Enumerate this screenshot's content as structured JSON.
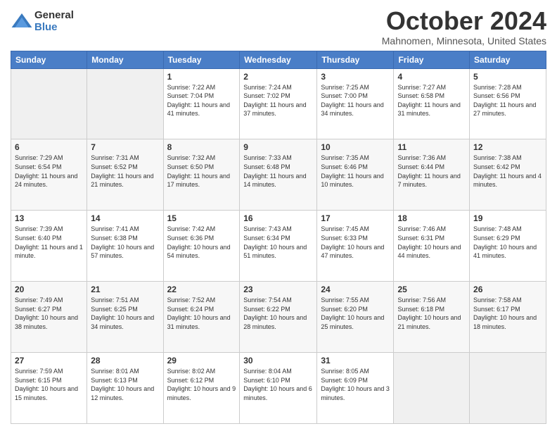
{
  "logo": {
    "general": "General",
    "blue": "Blue"
  },
  "title": "October 2024",
  "location": "Mahnomen, Minnesota, United States",
  "days_of_week": [
    "Sunday",
    "Monday",
    "Tuesday",
    "Wednesday",
    "Thursday",
    "Friday",
    "Saturday"
  ],
  "weeks": [
    [
      {
        "day": "",
        "info": ""
      },
      {
        "day": "",
        "info": ""
      },
      {
        "day": "1",
        "info": "Sunrise: 7:22 AM\nSunset: 7:04 PM\nDaylight: 11 hours and 41 minutes."
      },
      {
        "day": "2",
        "info": "Sunrise: 7:24 AM\nSunset: 7:02 PM\nDaylight: 11 hours and 37 minutes."
      },
      {
        "day": "3",
        "info": "Sunrise: 7:25 AM\nSunset: 7:00 PM\nDaylight: 11 hours and 34 minutes."
      },
      {
        "day": "4",
        "info": "Sunrise: 7:27 AM\nSunset: 6:58 PM\nDaylight: 11 hours and 31 minutes."
      },
      {
        "day": "5",
        "info": "Sunrise: 7:28 AM\nSunset: 6:56 PM\nDaylight: 11 hours and 27 minutes."
      }
    ],
    [
      {
        "day": "6",
        "info": "Sunrise: 7:29 AM\nSunset: 6:54 PM\nDaylight: 11 hours and 24 minutes."
      },
      {
        "day": "7",
        "info": "Sunrise: 7:31 AM\nSunset: 6:52 PM\nDaylight: 11 hours and 21 minutes."
      },
      {
        "day": "8",
        "info": "Sunrise: 7:32 AM\nSunset: 6:50 PM\nDaylight: 11 hours and 17 minutes."
      },
      {
        "day": "9",
        "info": "Sunrise: 7:33 AM\nSunset: 6:48 PM\nDaylight: 11 hours and 14 minutes."
      },
      {
        "day": "10",
        "info": "Sunrise: 7:35 AM\nSunset: 6:46 PM\nDaylight: 11 hours and 10 minutes."
      },
      {
        "day": "11",
        "info": "Sunrise: 7:36 AM\nSunset: 6:44 PM\nDaylight: 11 hours and 7 minutes."
      },
      {
        "day": "12",
        "info": "Sunrise: 7:38 AM\nSunset: 6:42 PM\nDaylight: 11 hours and 4 minutes."
      }
    ],
    [
      {
        "day": "13",
        "info": "Sunrise: 7:39 AM\nSunset: 6:40 PM\nDaylight: 11 hours and 1 minute."
      },
      {
        "day": "14",
        "info": "Sunrise: 7:41 AM\nSunset: 6:38 PM\nDaylight: 10 hours and 57 minutes."
      },
      {
        "day": "15",
        "info": "Sunrise: 7:42 AM\nSunset: 6:36 PM\nDaylight: 10 hours and 54 minutes."
      },
      {
        "day": "16",
        "info": "Sunrise: 7:43 AM\nSunset: 6:34 PM\nDaylight: 10 hours and 51 minutes."
      },
      {
        "day": "17",
        "info": "Sunrise: 7:45 AM\nSunset: 6:33 PM\nDaylight: 10 hours and 47 minutes."
      },
      {
        "day": "18",
        "info": "Sunrise: 7:46 AM\nSunset: 6:31 PM\nDaylight: 10 hours and 44 minutes."
      },
      {
        "day": "19",
        "info": "Sunrise: 7:48 AM\nSunset: 6:29 PM\nDaylight: 10 hours and 41 minutes."
      }
    ],
    [
      {
        "day": "20",
        "info": "Sunrise: 7:49 AM\nSunset: 6:27 PM\nDaylight: 10 hours and 38 minutes."
      },
      {
        "day": "21",
        "info": "Sunrise: 7:51 AM\nSunset: 6:25 PM\nDaylight: 10 hours and 34 minutes."
      },
      {
        "day": "22",
        "info": "Sunrise: 7:52 AM\nSunset: 6:24 PM\nDaylight: 10 hours and 31 minutes."
      },
      {
        "day": "23",
        "info": "Sunrise: 7:54 AM\nSunset: 6:22 PM\nDaylight: 10 hours and 28 minutes."
      },
      {
        "day": "24",
        "info": "Sunrise: 7:55 AM\nSunset: 6:20 PM\nDaylight: 10 hours and 25 minutes."
      },
      {
        "day": "25",
        "info": "Sunrise: 7:56 AM\nSunset: 6:18 PM\nDaylight: 10 hours and 21 minutes."
      },
      {
        "day": "26",
        "info": "Sunrise: 7:58 AM\nSunset: 6:17 PM\nDaylight: 10 hours and 18 minutes."
      }
    ],
    [
      {
        "day": "27",
        "info": "Sunrise: 7:59 AM\nSunset: 6:15 PM\nDaylight: 10 hours and 15 minutes."
      },
      {
        "day": "28",
        "info": "Sunrise: 8:01 AM\nSunset: 6:13 PM\nDaylight: 10 hours and 12 minutes."
      },
      {
        "day": "29",
        "info": "Sunrise: 8:02 AM\nSunset: 6:12 PM\nDaylight: 10 hours and 9 minutes."
      },
      {
        "day": "30",
        "info": "Sunrise: 8:04 AM\nSunset: 6:10 PM\nDaylight: 10 hours and 6 minutes."
      },
      {
        "day": "31",
        "info": "Sunrise: 8:05 AM\nSunset: 6:09 PM\nDaylight: 10 hours and 3 minutes."
      },
      {
        "day": "",
        "info": ""
      },
      {
        "day": "",
        "info": ""
      }
    ]
  ]
}
